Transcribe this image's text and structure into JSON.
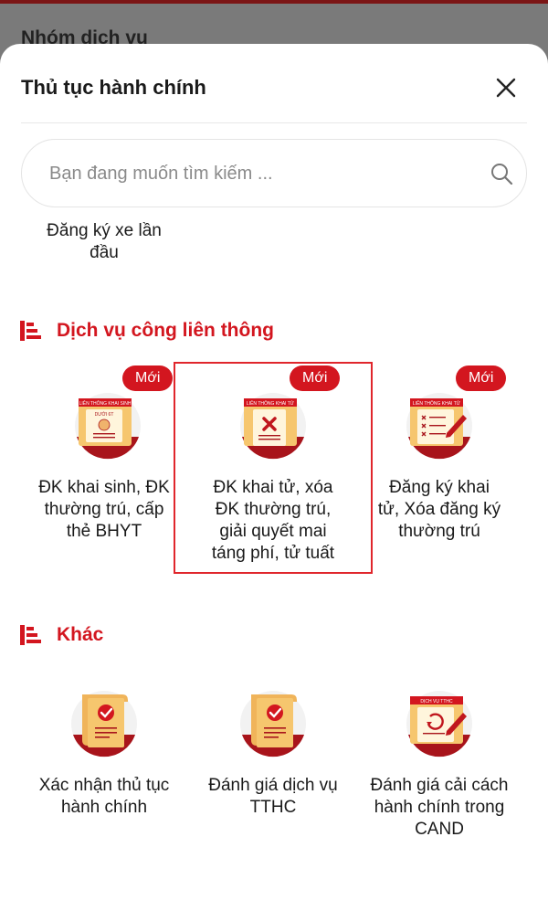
{
  "backdrop": {
    "title": "Nhóm dịch vụ"
  },
  "sheet": {
    "title": "Thủ tục hành chính",
    "close_icon": "close-icon"
  },
  "search": {
    "placeholder": "Bạn đang muốn tìm kiếm ...",
    "icon": "search-icon"
  },
  "partial_item": {
    "label_line1": "Đăng ký xe lần",
    "label_line2": "đầu"
  },
  "sections": [
    {
      "title": "Dịch vụ công liên thông",
      "items": [
        {
          "badge": "Mới",
          "art_caption": "LIÊN THÔNG KHAI SINH",
          "art_sub": "DƯỚI 6T",
          "label_lines": [
            "ĐK khai sinh, ĐK",
            "thường trú, cấp",
            "thẻ BHYT"
          ]
        },
        {
          "badge": "Mới",
          "art_caption": "LIÊN THÔNG KHAI TỬ",
          "label_lines": [
            "ĐK khai tử, xóa",
            "ĐK thường trú,",
            "giải quyết mai",
            "táng phí, tử tuất"
          ],
          "highlighted": true
        },
        {
          "badge": "Mới",
          "art_caption": "LIÊN THÔNG KHAI TỬ",
          "label_lines": [
            "Đăng ký khai",
            "tử, Xóa đăng ký",
            "thường trú"
          ]
        }
      ]
    },
    {
      "title": "Khác",
      "items": [
        {
          "label_lines": [
            "Xác nhận thủ tục",
            "hành chính"
          ]
        },
        {
          "label_lines": [
            "Đánh giá dịch vụ",
            "TTHC"
          ]
        },
        {
          "art_caption": "DỊCH VỤ TTHC",
          "label_lines": [
            "Đánh giá cải cách",
            "hành chính trong",
            "CAND"
          ]
        }
      ]
    }
  ],
  "colors": {
    "accent": "#d3161f",
    "art_bg": "#f2f2f2",
    "art_arc": "#a8141b",
    "scroll": "#f4c46a"
  }
}
